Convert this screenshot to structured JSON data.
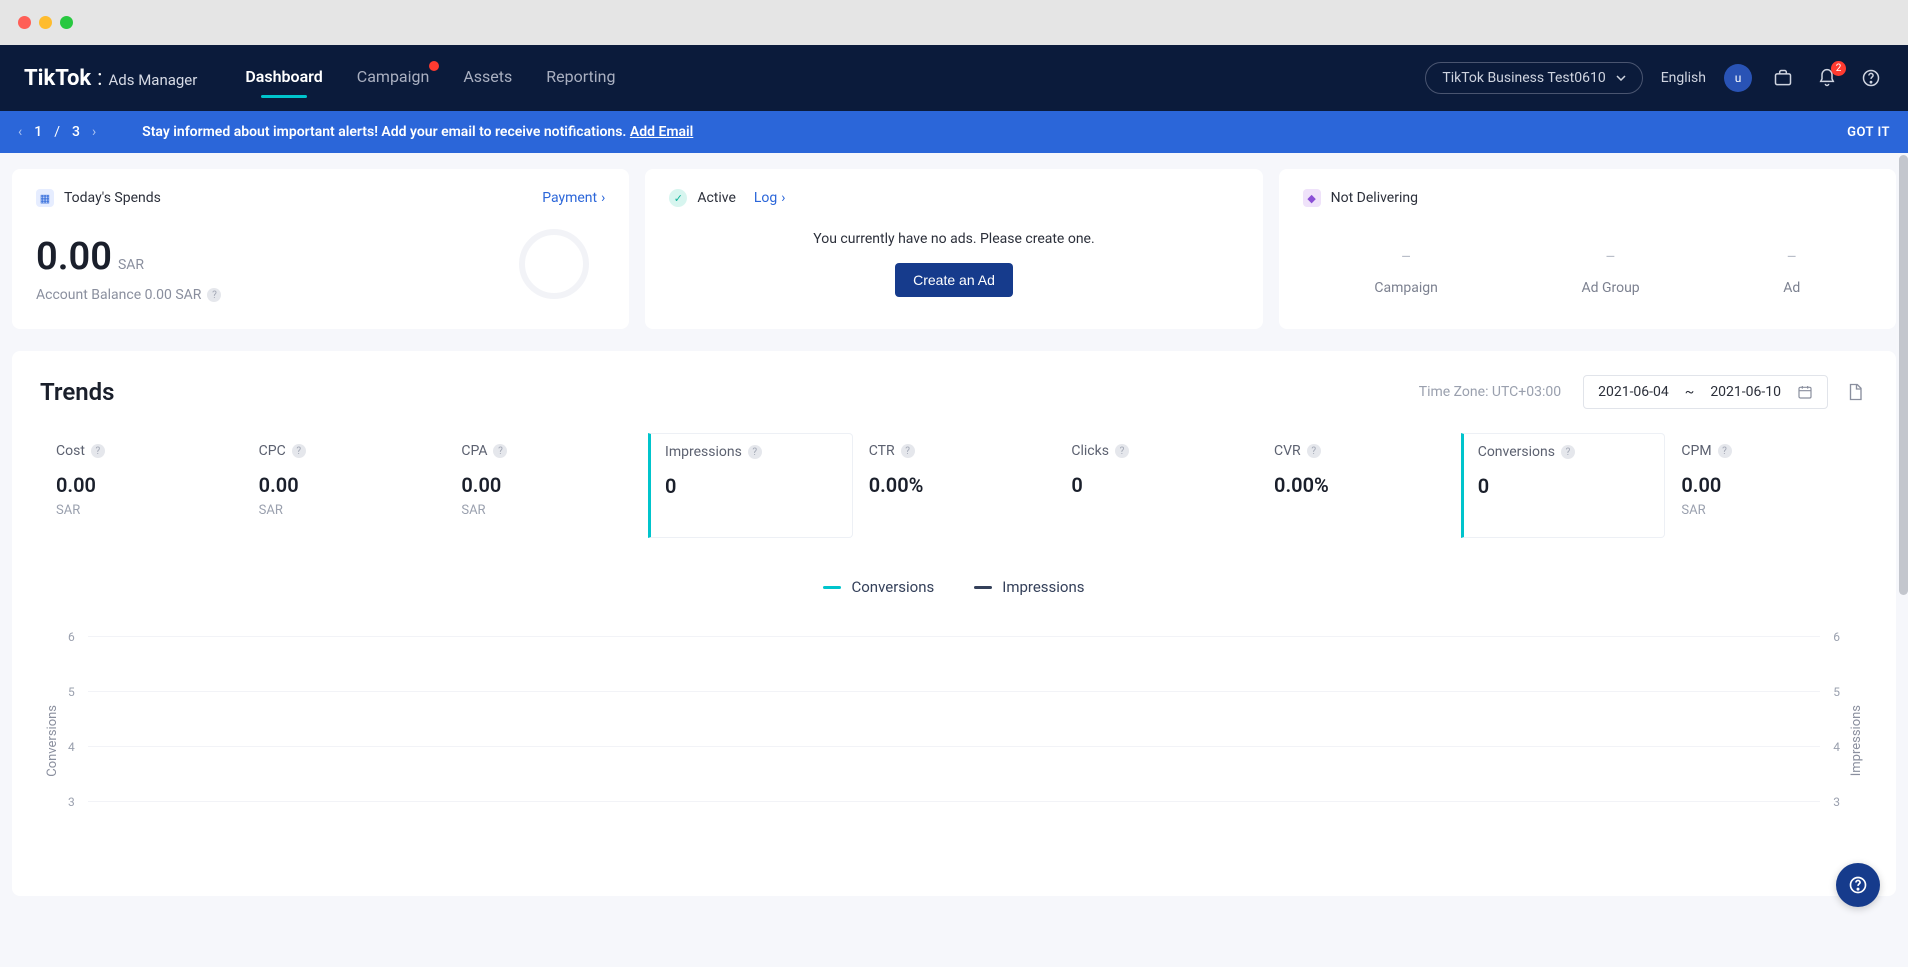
{
  "brand": {
    "name": "TikTok",
    "sub": "Ads Manager"
  },
  "nav": {
    "dashboard": "Dashboard",
    "campaign": "Campaign",
    "assets": "Assets",
    "reporting": "Reporting"
  },
  "account": {
    "name": "TikTok Business Test0610",
    "lang": "English",
    "avatar": "u",
    "bell_count": "2"
  },
  "alert": {
    "cur": "1",
    "sep": "/",
    "total": "3",
    "text": "Stay informed about important alerts! Add your email to receive notifications. ",
    "link": "Add Email",
    "gotit": "GOT IT"
  },
  "spend": {
    "title": "Today's Spends",
    "payment": "Payment",
    "amount": "0.00",
    "cur": "SAR",
    "balance": "Account Balance 0.00 SAR"
  },
  "active": {
    "title": "Active",
    "log": "Log",
    "empty": "You currently have no ads. Please create one.",
    "create": "Create an Ad"
  },
  "notdeliv": {
    "title": "Not Delivering",
    "c1": "Campaign",
    "c2": "Ad Group",
    "c3": "Ad"
  },
  "trends": {
    "title": "Trends",
    "tz": "Time Zone: UTC+03:00",
    "date_from": "2021-06-04",
    "date_sep": "~",
    "date_to": "2021-06-10"
  },
  "metrics": [
    {
      "label": "Cost",
      "value": "0.00",
      "currency": "SAR"
    },
    {
      "label": "CPC",
      "value": "0.00",
      "currency": "SAR"
    },
    {
      "label": "CPA",
      "value": "0.00",
      "currency": "SAR"
    },
    {
      "label": "Impressions",
      "value": "0",
      "currency": "",
      "selected": true
    },
    {
      "label": "CTR",
      "value": "0.00%",
      "currency": ""
    },
    {
      "label": "Clicks",
      "value": "0",
      "currency": ""
    },
    {
      "label": "CVR",
      "value": "0.00%",
      "currency": ""
    },
    {
      "label": "Conversions",
      "value": "0",
      "currency": "",
      "selected": true
    },
    {
      "label": "CPM",
      "value": "0.00",
      "currency": "SAR"
    }
  ],
  "legend": {
    "a": "Conversions",
    "b": "Impressions"
  },
  "chart_data": {
    "type": "line",
    "series": [
      {
        "name": "Conversions",
        "values": []
      },
      {
        "name": "Impressions",
        "values": []
      }
    ],
    "ylabel_left": "Conversions",
    "ylabel_right": "Impressions",
    "ylim": [
      0,
      6
    ],
    "ticks": [
      6,
      5,
      4,
      3
    ]
  }
}
